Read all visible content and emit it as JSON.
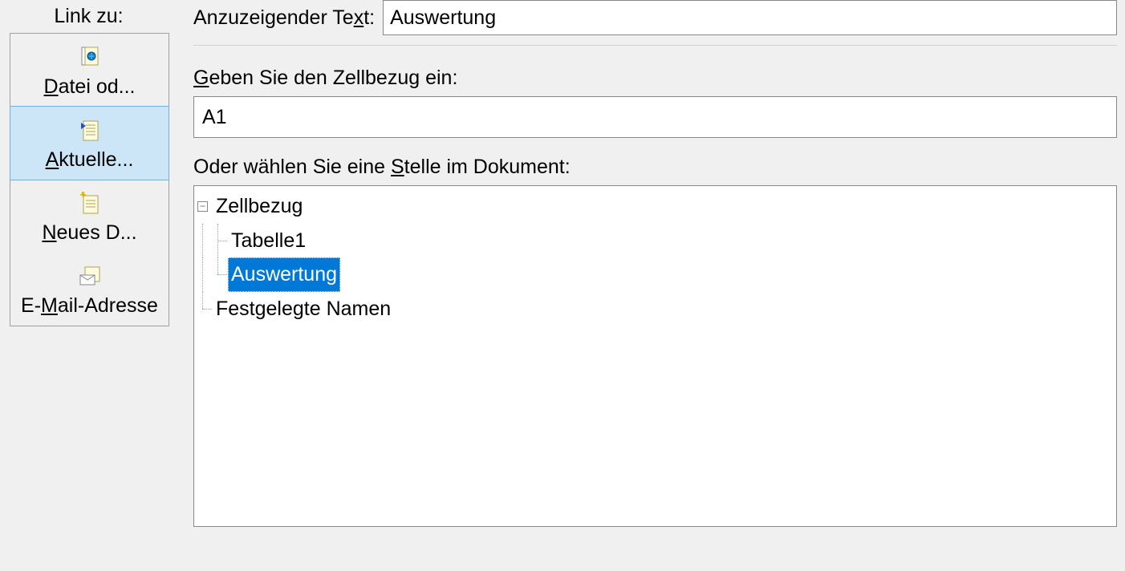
{
  "sidebar": {
    "title": "Link zu:",
    "items": [
      {
        "label": "Datei od...",
        "u_index": 0
      },
      {
        "label": "Aktuelle...",
        "u_index": 0
      },
      {
        "label": "Neues D...",
        "u_index": 0
      },
      {
        "label": "E-Mail-Adresse",
        "u_index": 2
      }
    ],
    "selected_index": 1
  },
  "display_text": {
    "label_pre": "Anzuzeigender Te",
    "label_u": "x",
    "label_post": "t:",
    "value": "Auswertung"
  },
  "cell_ref": {
    "label_u": "G",
    "label_post": "eben Sie den Zellbezug ein:",
    "value": "A1"
  },
  "tree": {
    "label_pre": "Oder wählen Sie eine ",
    "label_u": "S",
    "label_post": "telle im Dokument:",
    "root": "Zellbezug",
    "children": [
      "Tabelle1",
      "Auswertung"
    ],
    "selected_child": 1,
    "sibling": "Festgelegte Namen"
  }
}
